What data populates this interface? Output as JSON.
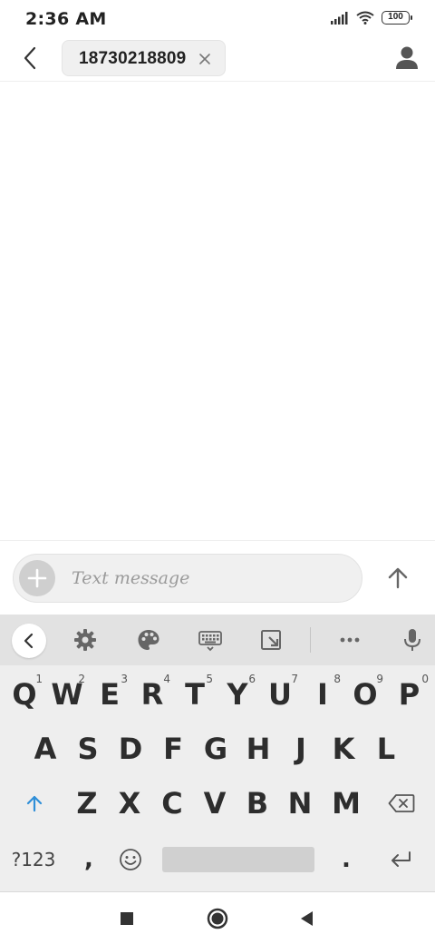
{
  "status_bar": {
    "time": "2:36 AM",
    "battery": "100"
  },
  "header": {
    "recipient": "18730218809"
  },
  "compose": {
    "placeholder": "Text message"
  },
  "keyboard": {
    "row1": [
      {
        "key": "Q",
        "hint": "1"
      },
      {
        "key": "W",
        "hint": "2"
      },
      {
        "key": "E",
        "hint": "3"
      },
      {
        "key": "R",
        "hint": "4"
      },
      {
        "key": "T",
        "hint": "5"
      },
      {
        "key": "Y",
        "hint": "6"
      },
      {
        "key": "U",
        "hint": "7"
      },
      {
        "key": "I",
        "hint": "8"
      },
      {
        "key": "O",
        "hint": "9"
      },
      {
        "key": "P",
        "hint": "0"
      }
    ],
    "row2": [
      "A",
      "S",
      "D",
      "F",
      "G",
      "H",
      "J",
      "K",
      "L"
    ],
    "row3": [
      "Z",
      "X",
      "C",
      "V",
      "B",
      "N",
      "M"
    ],
    "symbols_label": "?123",
    "comma": ",",
    "period": "."
  },
  "colors": {
    "shift_accent": "#2f8fd8",
    "keyboard_bg": "#eeeeee",
    "toolbar_bg": "#e2e2e2"
  }
}
